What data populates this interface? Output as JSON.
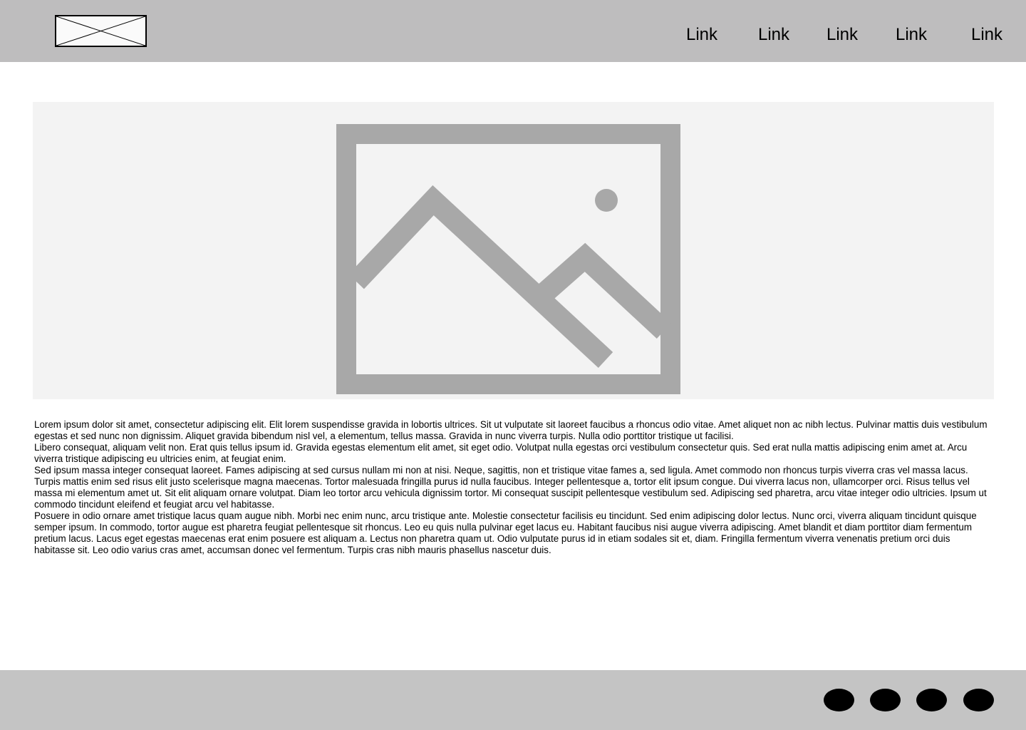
{
  "header": {
    "logo_icon": "logo-placeholder-icon",
    "nav_links": [
      "Link",
      "Link",
      "Link",
      "Link",
      "Link"
    ]
  },
  "hero": {
    "icon": "image-placeholder-icon",
    "background_color": "#f3f3f3",
    "icon_color": "#a8a8a8"
  },
  "content": {
    "paragraphs": [
      "Lorem ipsum dolor sit amet, consectetur adipiscing elit. Elit lorem suspendisse gravida in lobortis ultrices. Sit ut vulputate sit laoreet faucibus a rhoncus odio vitae. Amet aliquet non ac nibh lectus. Pulvinar mattis duis vestibulum egestas et sed nunc non dignissim. Aliquet gravida bibendum nisl vel, a elementum, tellus massa. Gravida in nunc viverra turpis. Nulla odio porttitor tristique ut facilisi.",
      "Libero consequat, aliquam velit non. Erat quis tellus ipsum id. Gravida egestas elementum elit amet, sit eget odio. Volutpat nulla egestas orci vestibulum consectetur quis. Sed erat nulla mattis adipiscing enim amet at. Arcu viverra tristique adipiscing eu ultricies enim, at feugiat enim.",
      "Sed ipsum massa integer consequat laoreet. Fames adipiscing at sed cursus nullam mi non at nisi. Neque, sagittis, non et tristique vitae fames a, sed ligula. Amet commodo non rhoncus turpis viverra cras vel massa lacus. Turpis mattis enim sed risus elit justo scelerisque magna maecenas. Tortor malesuada fringilla purus id nulla faucibus. Integer pellentesque a, tortor elit ipsum congue. Dui viverra lacus non, ullamcorper orci. Risus tellus vel massa mi elementum amet ut. Sit elit aliquam ornare volutpat. Diam leo tortor arcu vehicula dignissim tortor. Mi consequat suscipit pellentesque vestibulum sed. Adipiscing sed pharetra, arcu vitae integer odio ultricies. Ipsum ut commodo tincidunt eleifend et feugiat arcu vel habitasse.",
      "Posuere in odio ornare amet tristique lacus quam augue nibh. Morbi nec enim nunc, arcu tristique ante. Molestie consectetur facilisis eu tincidunt. Sed enim adipiscing dolor lectus. Nunc orci, viverra aliquam tincidunt quisque semper ipsum. In commodo, tortor augue est pharetra feugiat pellentesque sit rhoncus. Leo eu quis nulla pulvinar eget lacus eu. Habitant faucibus nisi augue viverra adipiscing. Amet blandit et diam porttitor diam fermentum pretium lacus. Lacus eget egestas maecenas erat enim posuere est aliquam a. Lectus non pharetra quam ut. Odio vulputate purus id in etiam sodales sit et, diam. Fringilla fermentum viverra venenatis pretium orci duis habitasse sit. Leo odio varius cras amet, accumsan donec vel fermentum. Turpis cras nibh mauris phasellus nascetur duis."
    ]
  },
  "footer": {
    "social_icons": [
      "social-icon-1",
      "social-icon-2",
      "social-icon-3",
      "social-icon-4"
    ]
  },
  "colors": {
    "header_bg": "#bebdbe",
    "footer_bg": "#c4c4c4",
    "text": "#000000"
  }
}
